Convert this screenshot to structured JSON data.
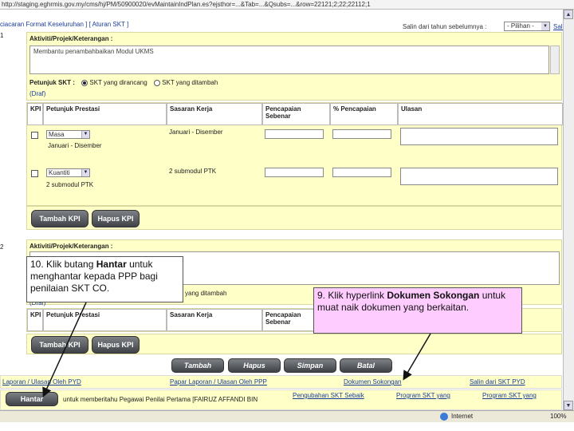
{
  "browser": {
    "url": "http://staging.eghrmis.gov.my/cms/hj/PM/50900020/evMaintainIndPlan.es?ejsthor=...&Tab=...&Qsubs=...&row=22121;2;22;22112;1"
  },
  "topnav": {
    "text": "ciacaran Format Keseluruhan ]  [ Aturan SKT ]",
    "copy_label": "Salin dari tahun sebelumnya :",
    "copy_select": "- Pilihan -",
    "salin": "Salin"
  },
  "section1": {
    "index": "1",
    "header": "Aktiviti/Projek/Keterangan :",
    "activity_text": "Membantu penambahbaikan Modul UKMS",
    "petunjuk_label": "Petunjuk SKT :",
    "radio1": "SKT yang dirancang",
    "radio2": "SKT yang ditambah",
    "draft": "(Draf)"
  },
  "table": {
    "headers": [
      "KPI",
      "Petunjuk Prestasi",
      "Sasaran Kerja",
      "Pencapaian Sebenar",
      "% Pencapaian",
      "Ulasan"
    ],
    "rows": [
      {
        "dropdown": "Masa",
        "desc": "Januari - Disember",
        "sasaran": "Januari - Disember"
      },
      {
        "dropdown": "Kuantiti",
        "desc": "2 submodul PTK",
        "sasaran": "2 submodul PTK"
      }
    ]
  },
  "buttons": {
    "tambah_kpi": "Tambah KPI",
    "hapus_kpi": "Hapus KPI",
    "tambah": "Tambah",
    "hapus": "Hapus",
    "simpan": "Simpan",
    "batal": "Batal",
    "hantar": "Hantar"
  },
  "section2": {
    "index": "2",
    "header": "Aktiviti/Projek/Keterangan :",
    "partial_radio": "yang ditambah",
    "draft": "(Draf)"
  },
  "table2": {
    "headers": [
      "KPI",
      "Petunjuk Prestasi",
      "Sasaran Kerja",
      "Pencapaian Sebenar"
    ]
  },
  "callouts": {
    "c10_pre": "10. Klik butang ",
    "c10_bold": "Hantar",
    "c10_post": " untuk menghantar kepada PPP bagi penilaian SKT CO.",
    "c9_pre": "9. Klik hyperlink ",
    "c9_bold": "Dokumen Sokongan",
    "c9_post": " untuk muat naik dokumen yang berkaitan."
  },
  "bottom_links": {
    "l1": "Laporan / Ulasan Oleh PYD",
    "l2": "Papar Laporan / Ulasan Oleh PPP",
    "l3": "Dokumen Sokongan",
    "l4": "Salin dari SKT PYD",
    "l5": "Pengubahan SKT Sebaik",
    "l6": "Program SKT yang",
    "l7": "Program SKT yang",
    "hantar_note": "untuk memberitahu Pegawai Penilai Pertama [FAIRUZ AFFANDI BIN"
  },
  "status": {
    "zone": "Internet",
    "zoom": "100%"
  },
  "colors": {
    "yellow": "#ffffc8",
    "button": "#4a4e52",
    "callout_pink": "#ffccff",
    "link": "#1a3c9c"
  }
}
